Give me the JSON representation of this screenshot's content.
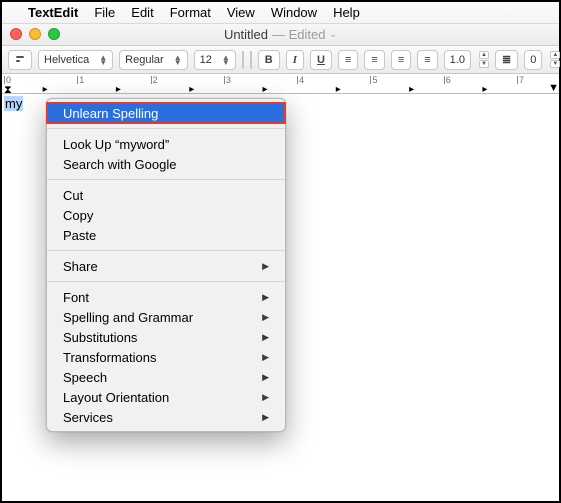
{
  "menubar": {
    "apple": "",
    "appname": "TextEdit",
    "items": [
      "File",
      "Edit",
      "Format",
      "View",
      "Window",
      "Help"
    ]
  },
  "titlebar": {
    "title": "Untitled",
    "subtitle": "— Edited"
  },
  "toolbar": {
    "font_family": "Helvetica",
    "font_style": "Regular",
    "font_size": "12",
    "bold": "B",
    "italic": "I",
    "underline": "U",
    "spacing": "1.0",
    "list_level": "0"
  },
  "ruler": {
    "numbers": [
      "0",
      "1",
      "2",
      "3",
      "4",
      "5",
      "6",
      "7"
    ]
  },
  "document": {
    "selected_text": "my"
  },
  "context_menu": {
    "groups": [
      [
        {
          "label": "Unlearn Spelling",
          "submenu": false,
          "highlight": true
        }
      ],
      [
        {
          "label": "Look Up “myword”",
          "submenu": false
        },
        {
          "label": "Search with Google",
          "submenu": false
        }
      ],
      [
        {
          "label": "Cut",
          "submenu": false
        },
        {
          "label": "Copy",
          "submenu": false
        },
        {
          "label": "Paste",
          "submenu": false
        }
      ],
      [
        {
          "label": "Share",
          "submenu": true
        }
      ],
      [
        {
          "label": "Font",
          "submenu": true
        },
        {
          "label": "Spelling and Grammar",
          "submenu": true
        },
        {
          "label": "Substitutions",
          "submenu": true
        },
        {
          "label": "Transformations",
          "submenu": true
        },
        {
          "label": "Speech",
          "submenu": true
        },
        {
          "label": "Layout Orientation",
          "submenu": true
        },
        {
          "label": "Services",
          "submenu": true
        }
      ]
    ]
  }
}
